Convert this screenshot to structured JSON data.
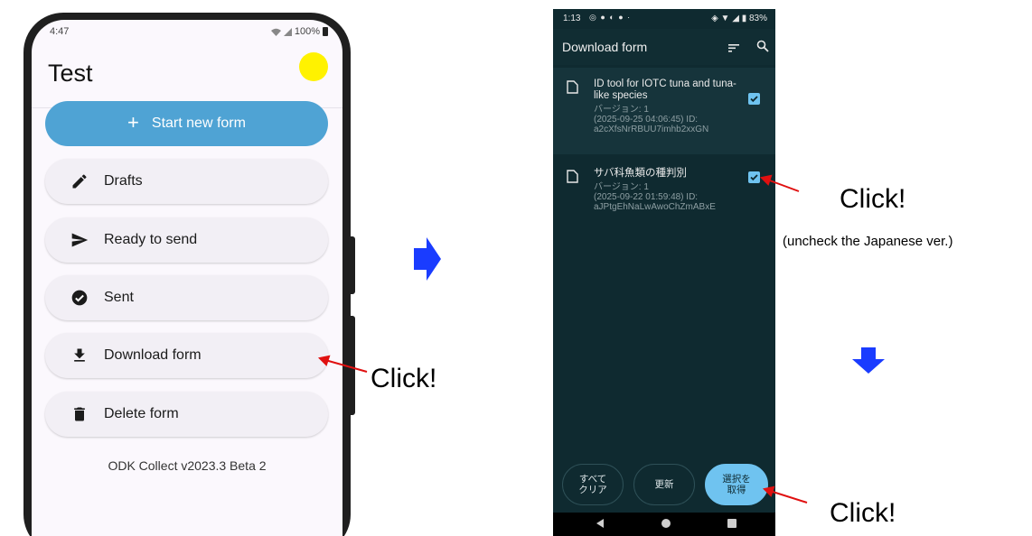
{
  "left_phone": {
    "status": {
      "time": "4:47",
      "battery": "100%"
    },
    "app_title": "Test",
    "buttons": {
      "start_new_form": "Start new form",
      "drafts": "Drafts",
      "ready_to_send": "Ready to send",
      "sent": "Sent",
      "download_form": "Download form",
      "delete_form": "Delete form"
    },
    "version": "ODK Collect v2023.3 Beta 2",
    "colors": {
      "primary": "#4fa3d4",
      "avatar": "#fff200"
    }
  },
  "right_phone": {
    "status": {
      "time": "1:13",
      "battery": "83%"
    },
    "title": "Download form",
    "forms": [
      {
        "title": "ID tool for IOTC tuna and tuna-like species",
        "version": "バージョン: 1",
        "date_id": "(2025-09-25 04:06:45) ID:",
        "id": "a2cXfsNrRBUU7imhb2xxGN",
        "checked": true
      },
      {
        "title": "サバ科魚類の種判別",
        "version": "バージョン: 1",
        "date_id": "(2025-09-22 01:59:48) ID:",
        "id": "aJPtgEhNaLwAwoChZmABxE",
        "checked": true
      }
    ],
    "buttons": {
      "clear_all": "すべて\nクリア",
      "refresh": "更新",
      "get_selected": "選択を\n取得"
    },
    "colors": {
      "background": "#0f2a30",
      "accent": "#6fc3f0"
    }
  },
  "annotations": {
    "click": "Click!",
    "note": "(uncheck the Japanese ver.)",
    "arrow_color": "#1a3cff",
    "pointer_color": "#e01010"
  }
}
